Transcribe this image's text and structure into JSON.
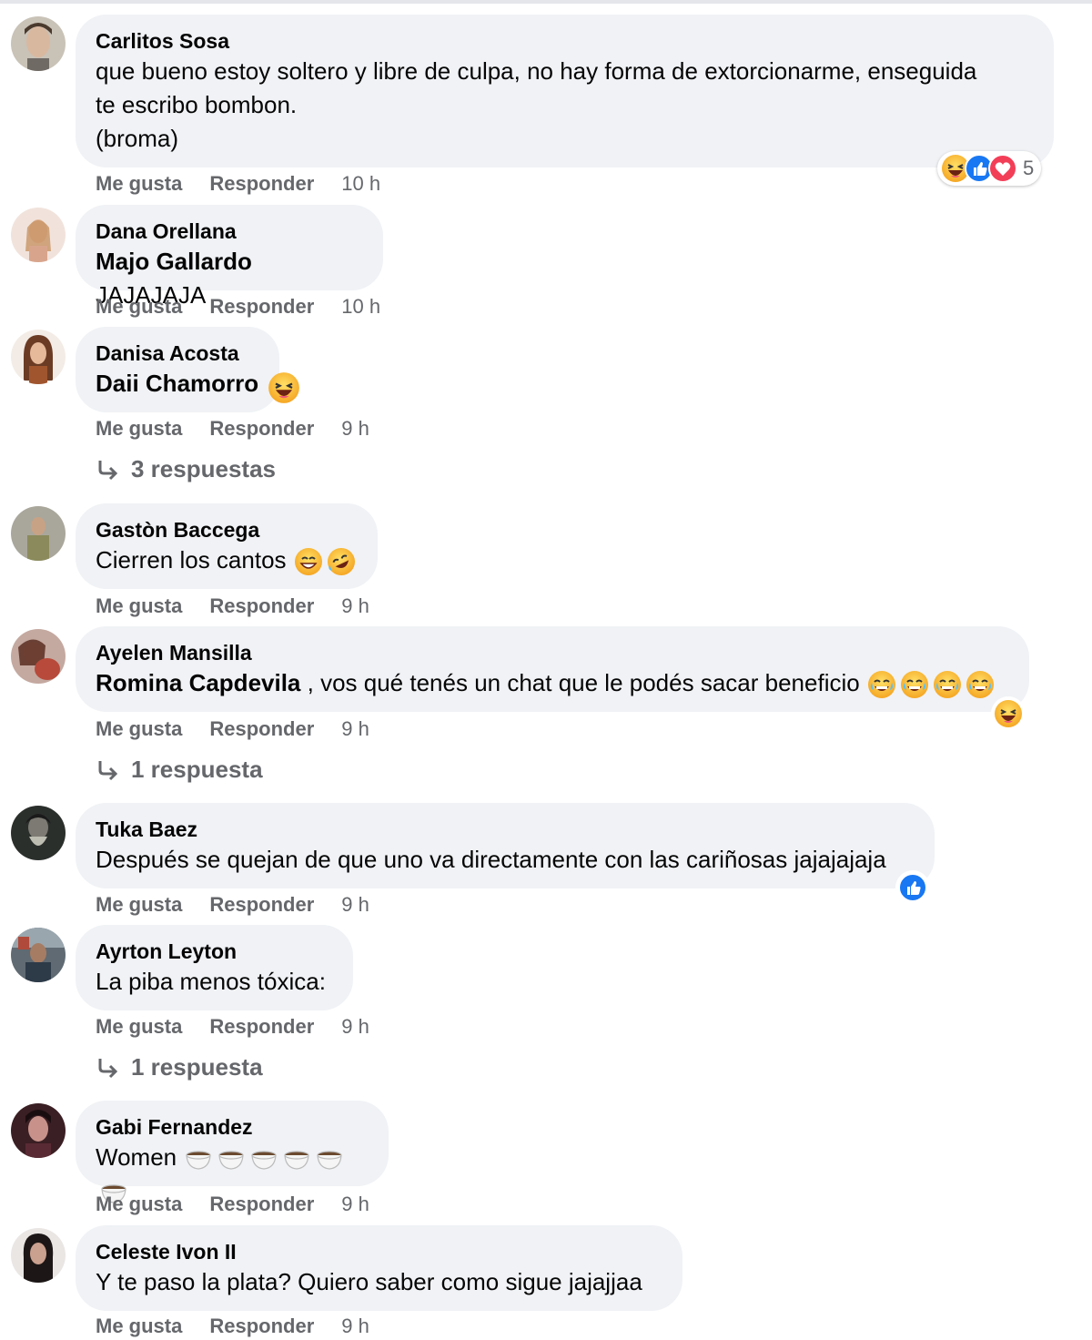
{
  "actions": {
    "like": "Me gusta",
    "reply": "Responder"
  },
  "comments": [
    {
      "author": "Carlitos Sosa",
      "text": "que bueno estoy soltero y libre de culpa, no hay forma de extorcionarme, enseguida\nte escribo bombon.\n(broma)",
      "time": "10 h",
      "reaction_count": "5"
    },
    {
      "author": "Dana Orellana",
      "mention": "Majo Gallardo",
      "text": " JAJAJAJA",
      "time": "10 h"
    },
    {
      "author": "Danisa Acosta",
      "mention": "Daii Chamorro",
      "text": "",
      "time": "9 h",
      "replies": "3 respuestas"
    },
    {
      "author": "Gastòn Baccega",
      "text": "Cierren los cantos",
      "time": "9 h"
    },
    {
      "author": "Ayelen Mansilla",
      "mention": "Romina Capdevila",
      "text": " , vos qué tenés un chat que le podés sacar beneficio",
      "time": "9 h",
      "replies": "1 respuesta"
    },
    {
      "author": "Tuka Baez",
      "text": "Después se quejan de que uno va directamente con las cariñosas jajajajaja",
      "time": "9 h"
    },
    {
      "author": "Ayrton Leyton",
      "text": "La piba menos tóxica:",
      "time": "9 h",
      "replies": "1 respuesta"
    },
    {
      "author": "Gabi Fernandez",
      "text": "Women",
      "time": "9 h"
    },
    {
      "author": "Celeste Ivon II",
      "text": "Y te paso la plata? Quiero saber como sigue jajajjaa",
      "time": "9 h"
    }
  ],
  "colors": {
    "bubble": "#f0f2f5",
    "secondary_text": "#65676b",
    "like_blue": "#1877f2",
    "love_red": "#f33e58",
    "haha_yellow": "#f7b125"
  }
}
